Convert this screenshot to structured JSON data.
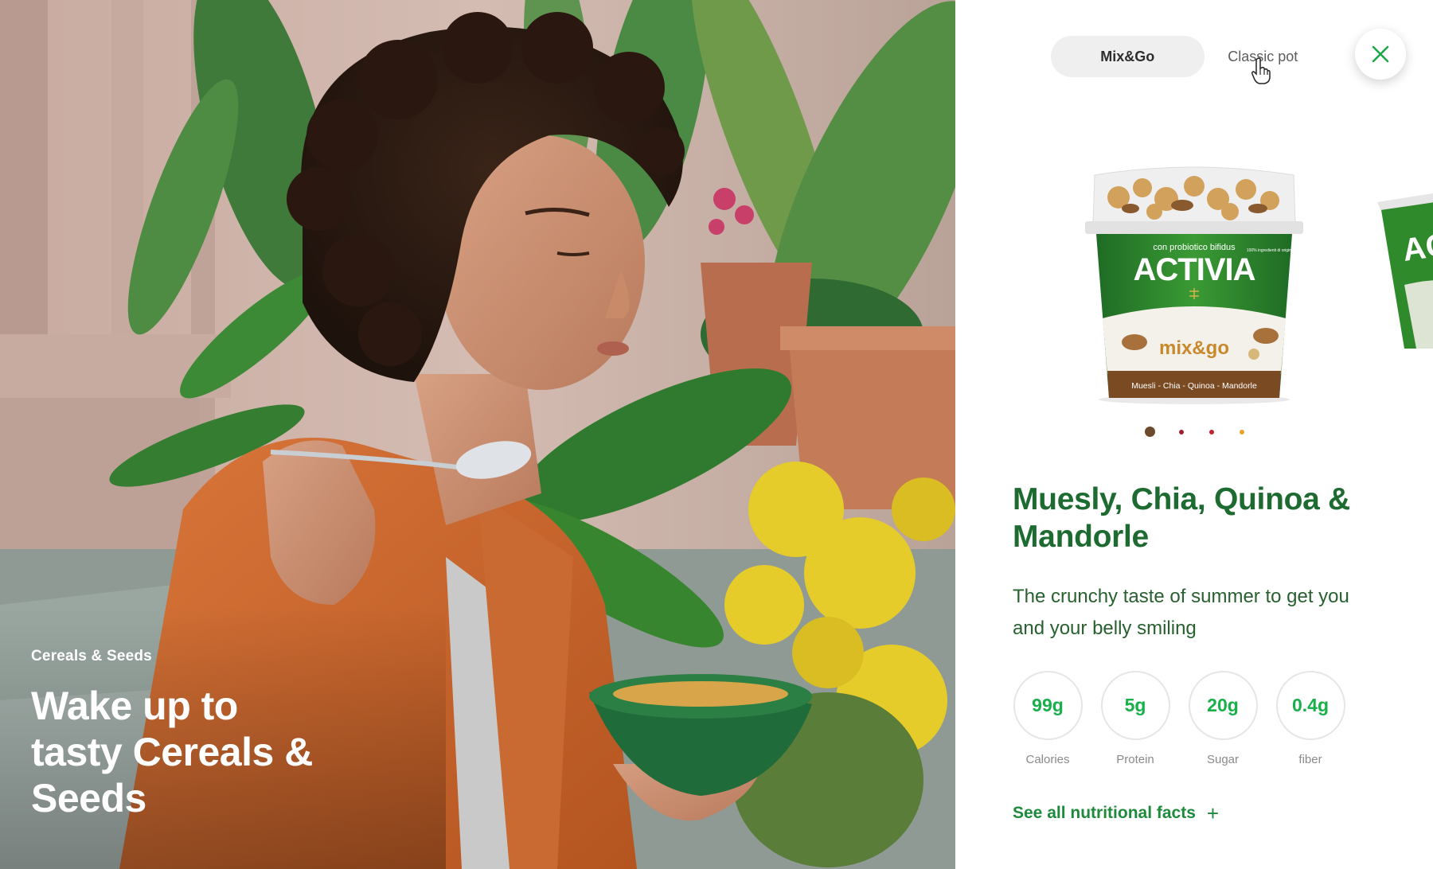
{
  "hero": {
    "category": "Cereals & Seeds",
    "title": "Wake up to tasty Cereals & Seeds",
    "image": "woman-eating-yogurt-photo"
  },
  "panel": {
    "toggle": {
      "options": [
        "Mix&Go",
        "Classic pot"
      ],
      "selected": "Mix&Go"
    },
    "close_icon": "close-icon",
    "carousel": {
      "product_pack": {
        "tagline": "con probiotico bifidus",
        "brand": "ACTIVIA",
        "subbrand": "mix&go",
        "flavour_band": "Muesli - Chia - Quinoa - Mandorle",
        "side_note": "100% ingredienti di origine naturale"
      },
      "peek_brand": "AC",
      "dot_count": 4,
      "active_dot": 1,
      "dot_colors": [
        "#6e4a2c",
        "#a11f2c",
        "#c4222f",
        "#eba02a"
      ]
    },
    "product_name": "Muesly, Chia, Quinoa & Mandorle",
    "description": "The crunchy taste of summer to get you and your belly smiling",
    "nutrients": [
      {
        "value": "99g",
        "label": "Calories"
      },
      {
        "value": "5g",
        "label": "Protein"
      },
      {
        "value": "20g",
        "label": "Sugar"
      },
      {
        "value": "0.4g",
        "label": "fiber"
      }
    ],
    "facts_link": "See all nutritional facts",
    "facts_icon": "+"
  },
  "colors": {
    "brand_green": "#1e6b31",
    "accent_green": "#18b04a",
    "pack_green": "#2e8a2c"
  }
}
